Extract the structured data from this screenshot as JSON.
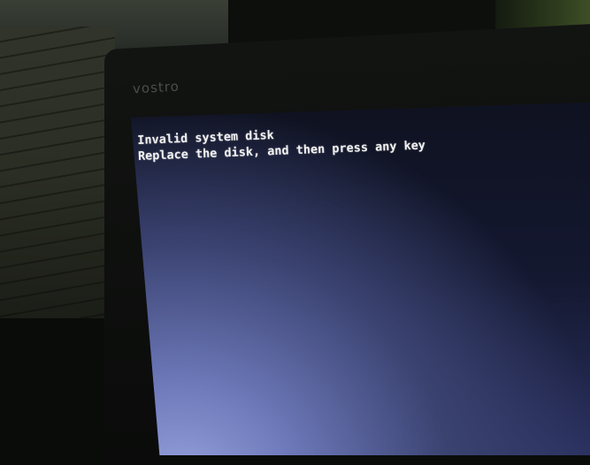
{
  "scene": "Laptop screen showing BIOS boot error",
  "laptop": {
    "brand_logo": "vostro"
  },
  "screen": {
    "lines": [
      "Invalid system disk",
      "Replace the disk, and then press any key"
    ]
  },
  "colors": {
    "text": "#f2f2f2",
    "screen_dark": "#0f1220",
    "screen_glow": "#9aa6e0",
    "bezel": "#0a0b0a"
  }
}
